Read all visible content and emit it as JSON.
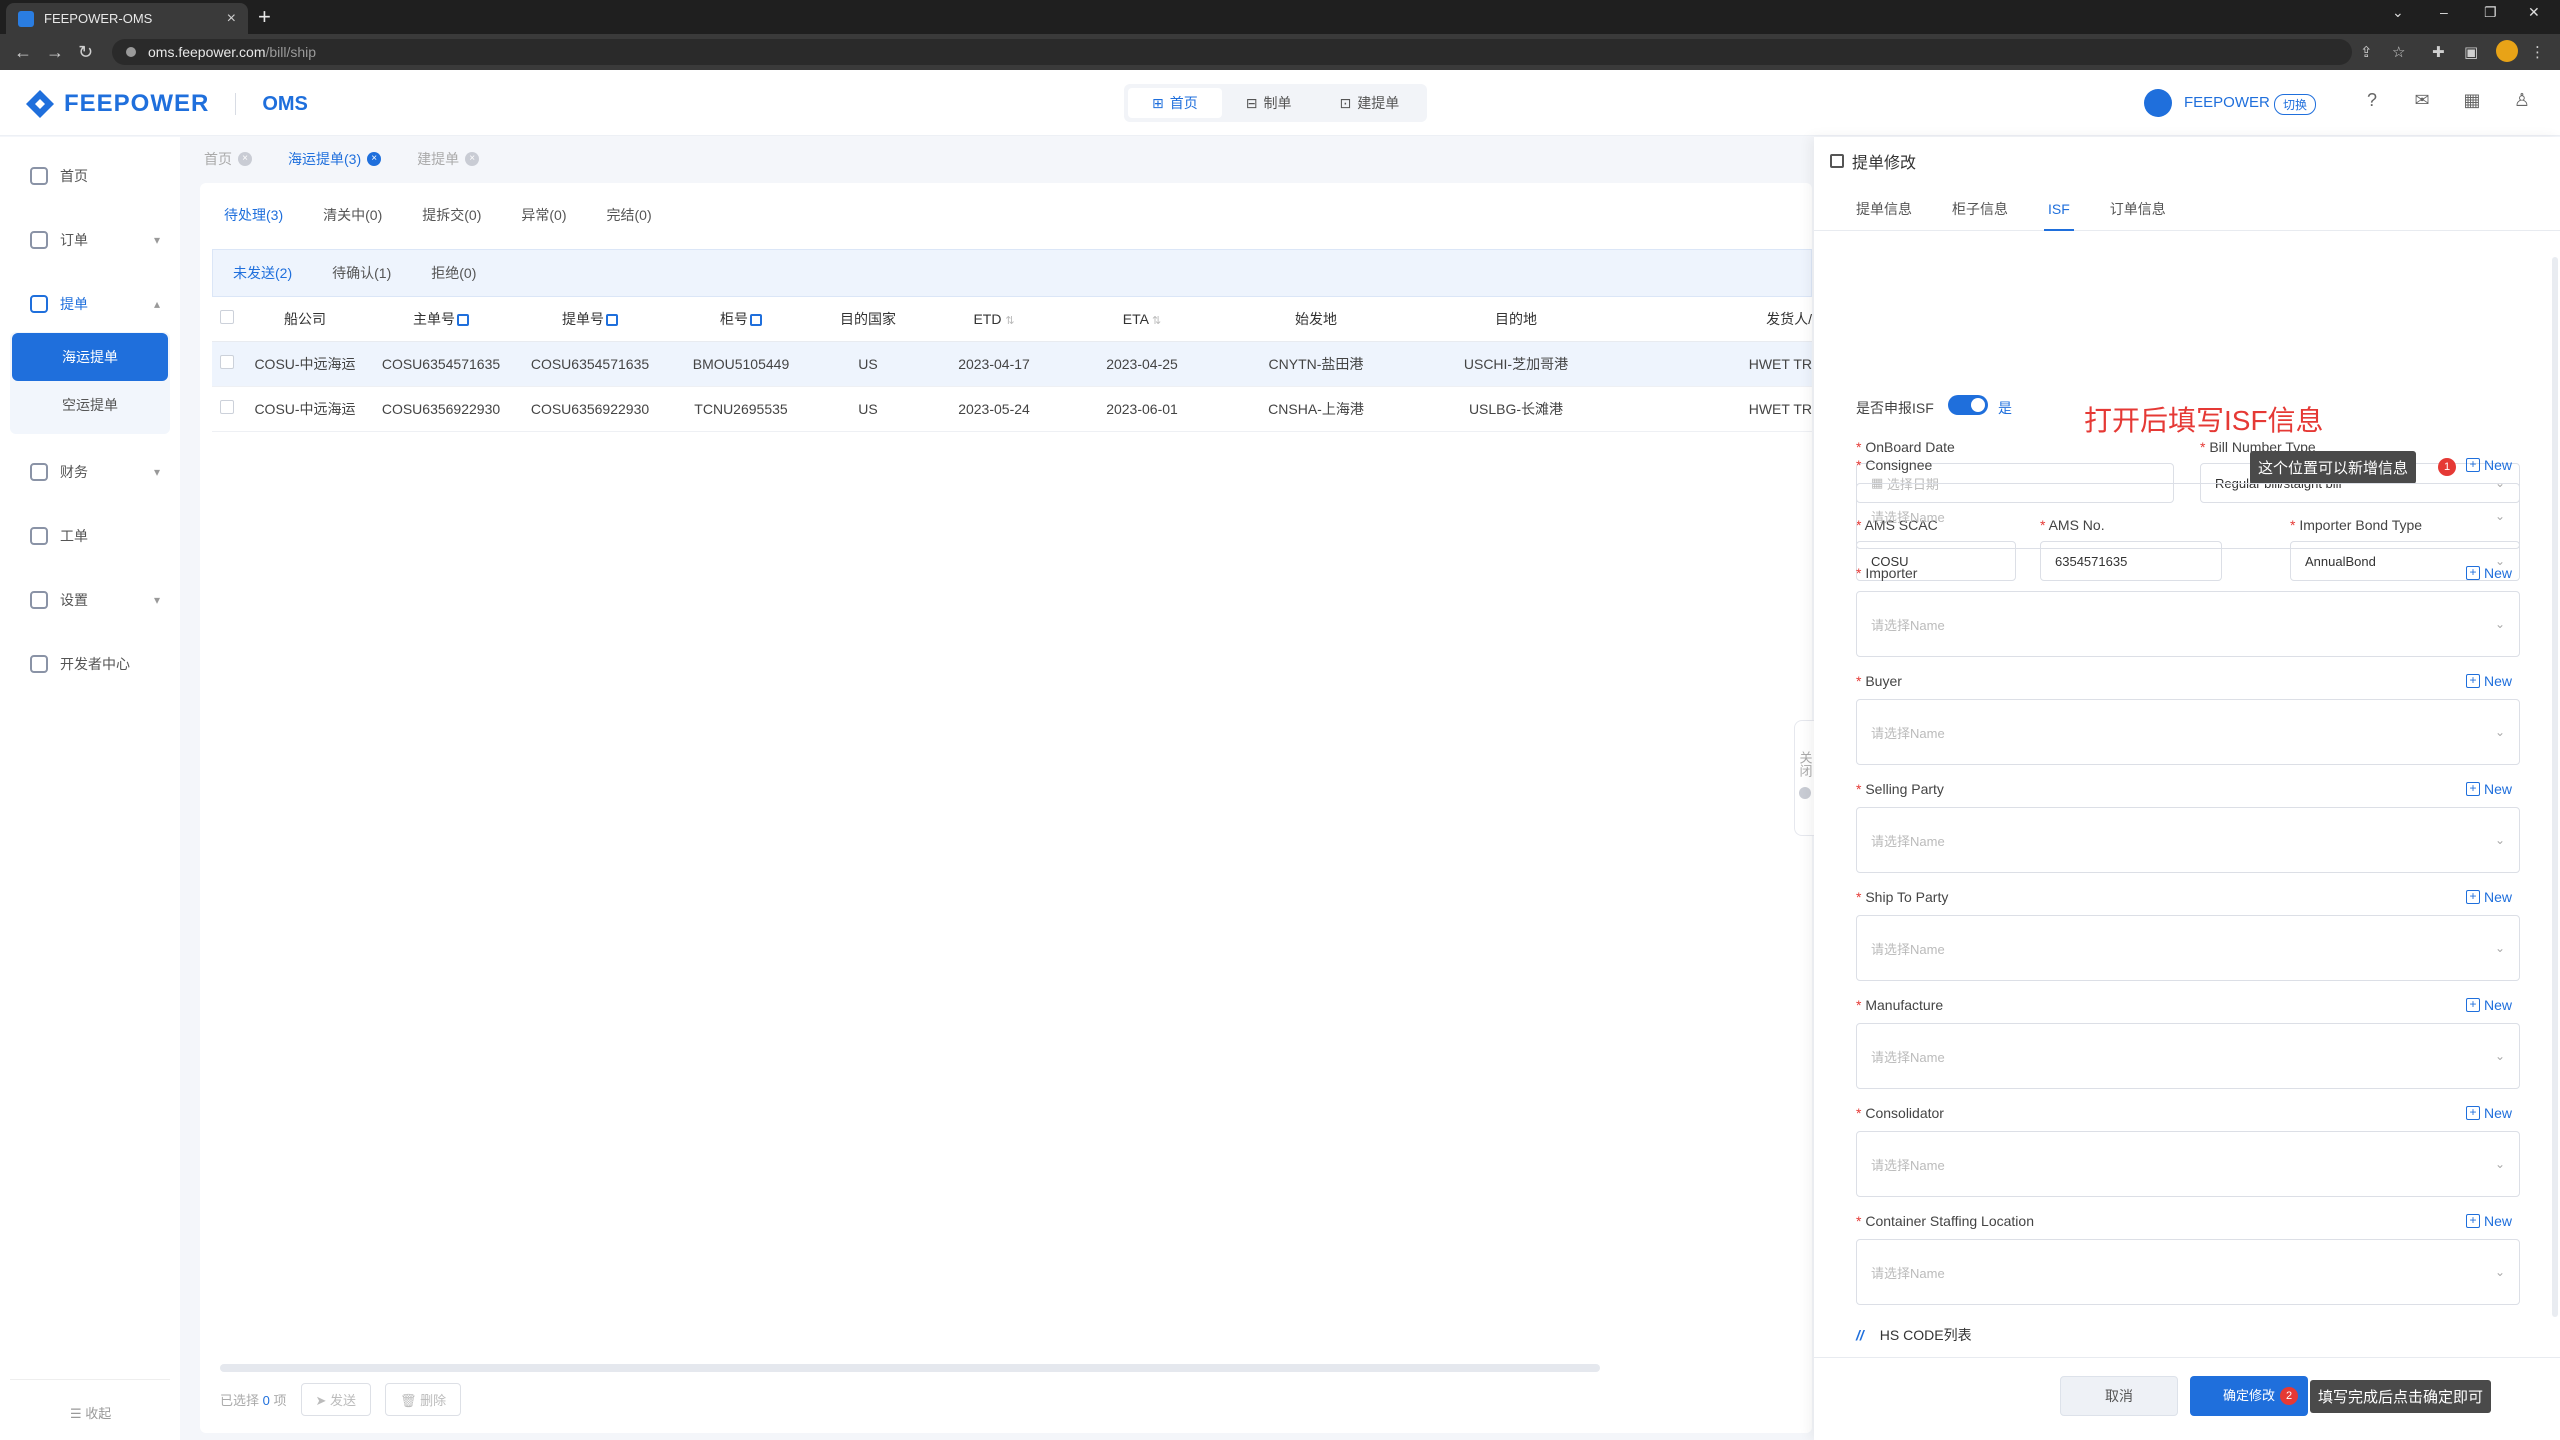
{
  "browser": {
    "tab_title": "FEEPOWER-OMS",
    "url_host": "oms.feepower.com",
    "url_path": "/bill/ship"
  },
  "header": {
    "brand": "FEEPOWER",
    "product": "OMS",
    "nav": [
      {
        "label": "首页",
        "icon": "grid-icon",
        "active": true
      },
      {
        "label": "制单",
        "icon": "user-doc-icon",
        "active": false
      },
      {
        "label": "建提单",
        "icon": "create-bill-icon",
        "active": false
      }
    ],
    "user_name": "FEEPOWER",
    "switch_label": "切换"
  },
  "sidebar": {
    "items": [
      {
        "label": "首页",
        "icon": "home-icon"
      },
      {
        "label": "订单",
        "icon": "order-icon"
      },
      {
        "label": "提单",
        "icon": "bill-icon"
      },
      {
        "label": "财务",
        "icon": "finance-icon"
      },
      {
        "label": "工单",
        "icon": "ticket-icon"
      },
      {
        "label": "设置",
        "icon": "settings-icon"
      },
      {
        "label": "开发者中心",
        "icon": "developer-icon"
      }
    ],
    "subitems": [
      {
        "label": "海运提单",
        "active": true
      },
      {
        "label": "空运提单",
        "active": false
      }
    ],
    "collapse_label": "收起"
  },
  "page_tabs": [
    {
      "label": "首页",
      "active": false
    },
    {
      "label": "海运提单(3)",
      "active": true
    },
    {
      "label": "建提单",
      "active": false
    }
  ],
  "status_tabs": [
    "待处理(3)",
    "清关中(0)",
    "提拆交(0)",
    "异常(0)",
    "完结(0)"
  ],
  "sub_tabs": [
    "未发送(2)",
    "待确认(1)",
    "拒绝(0)"
  ],
  "table": {
    "columns": [
      "船公司",
      "主单号",
      "提单号",
      "柜号",
      "目的国家",
      "ETD",
      "ETA",
      "始发地",
      "目的地",
      "发货人/"
    ],
    "rows": [
      [
        "COSU-中远海运",
        "COSU6354571635",
        "COSU6354571635",
        "BMOU5105449",
        "US",
        "2023-04-17",
        "2023-04-25",
        "CNYTN-盐田港",
        "USCHI-芝加哥港",
        "HWET TR"
      ],
      [
        "COSU-中远海运",
        "COSU6356922930",
        "COSU6356922930",
        "TCNU2695535",
        "US",
        "2023-05-24",
        "2023-06-01",
        "CNSHA-上海港",
        "USLBG-长滩港",
        "HWET TR"
      ]
    ]
  },
  "footer": {
    "selected_prefix": "已选择",
    "selected_count": "0",
    "selected_suffix": "项",
    "send_label": "发送",
    "delete_label": "删除"
  },
  "drawer": {
    "handle_label": "关闭",
    "title": "提单修改",
    "tabs": [
      {
        "label": "提单信息",
        "active": false
      },
      {
        "label": "柜子信息",
        "active": false
      },
      {
        "label": "ISF",
        "active": true
      },
      {
        "label": "订单信息",
        "active": false
      }
    ],
    "isf_label": "是否申报ISF",
    "isf_value": "是",
    "annotation_isf": "打开后填写ISF信息",
    "onboard_date_label": "OnBoard Date",
    "onboard_date_placeholder": "选择日期",
    "bill_type_label": "Bill Number Type",
    "bill_type_value": "Regular bill/staight bill",
    "ams_scac_label": "AMS SCAC",
    "ams_scac_value": "COSU",
    "ams_no_label": "AMS No.",
    "ams_no_value": "6354571635",
    "bond_type_label": "Importer Bond Type",
    "bond_type_value": "AnnualBond",
    "tooltip_new": "这个位置可以新增信息",
    "badge_1": "1",
    "new_label": "New",
    "party_placeholder": "请选择Name",
    "parties": [
      "Consignee",
      "Importer",
      "Buyer",
      "Selling Party",
      "Ship To Party",
      "Manufacture",
      "Consolidator",
      "Container Staffing Location"
    ],
    "hs_code_label": "HS CODE列表",
    "cancel_label": "取消",
    "confirm_label": "确定修改",
    "badge_2": "2",
    "tooltip_confirm": "填写完成后点击确定即可"
  }
}
